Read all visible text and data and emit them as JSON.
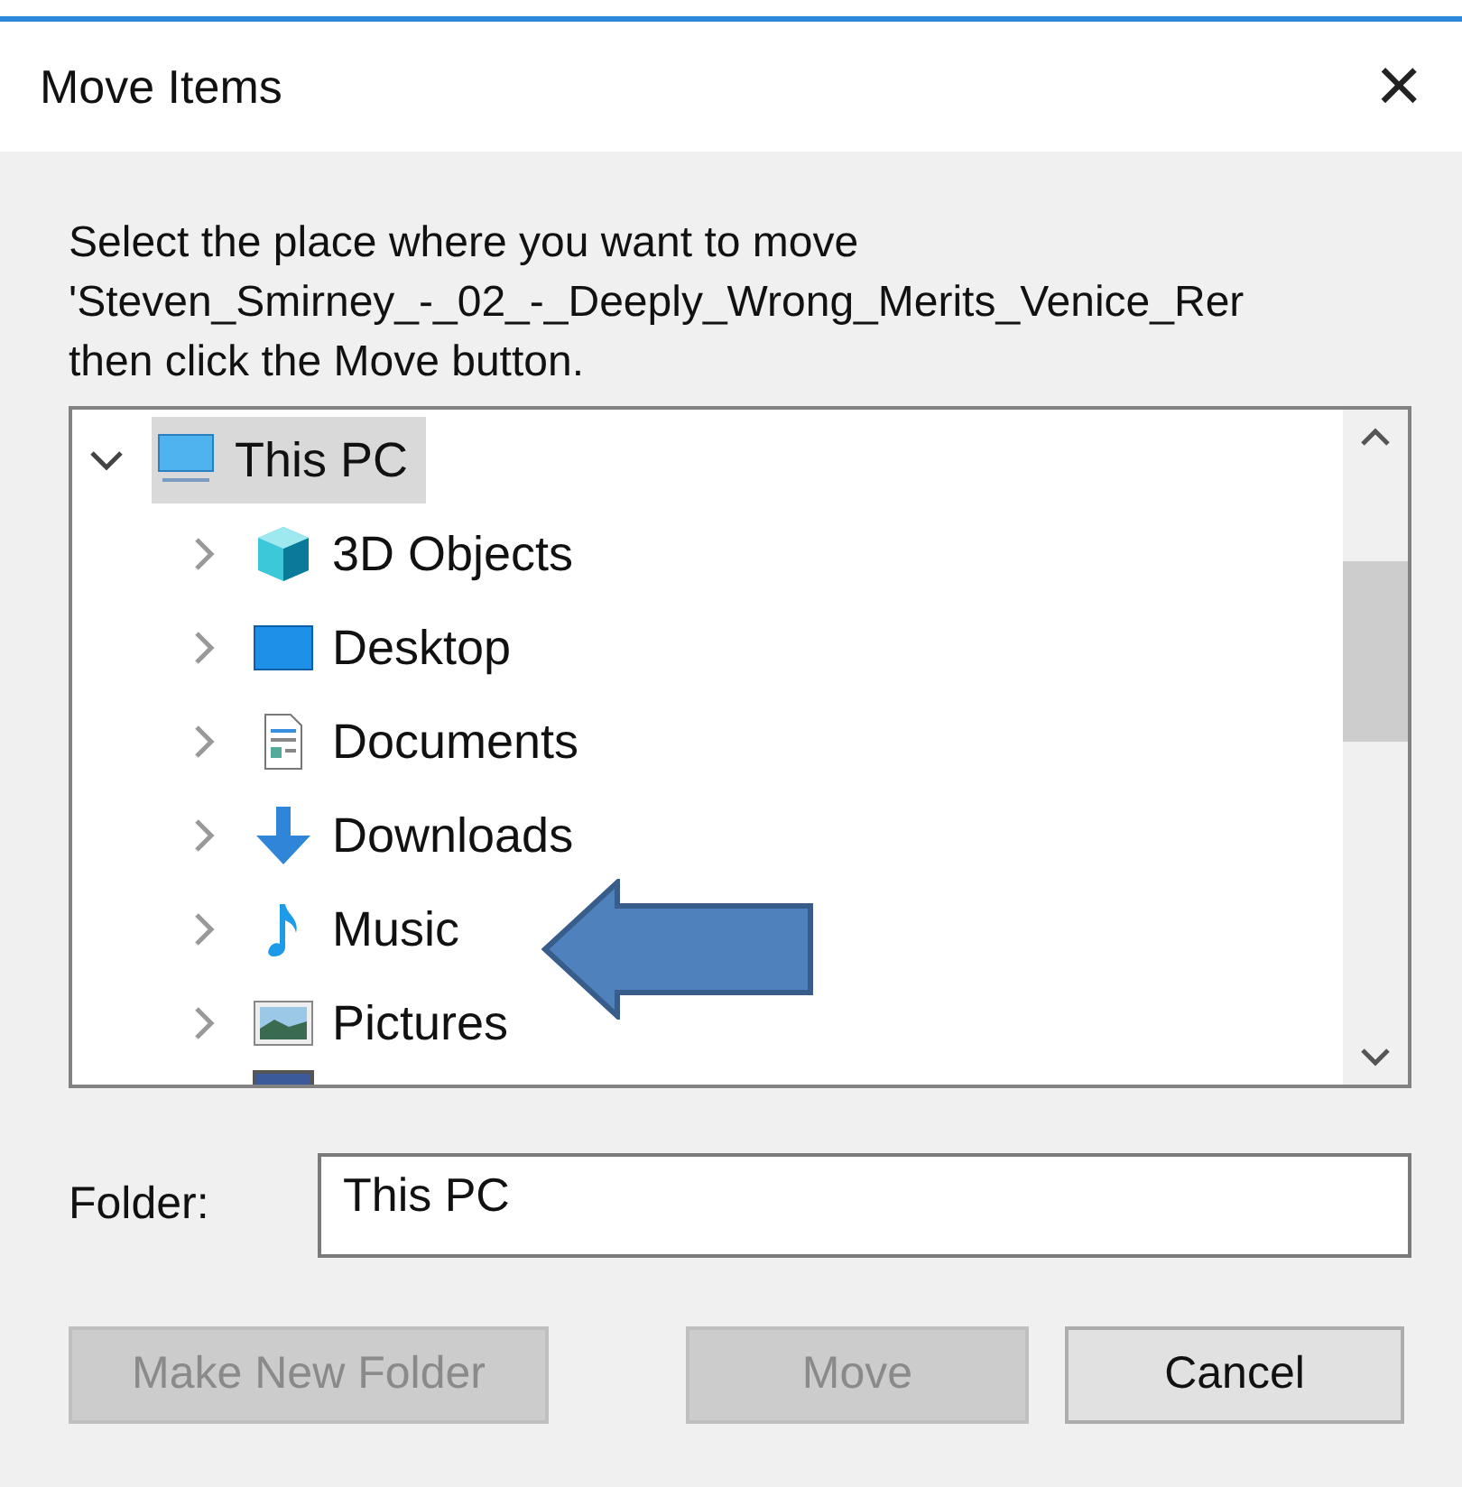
{
  "window": {
    "title": "Move Items",
    "close": "×"
  },
  "instructions": [
    "Select the place where you want to move",
    "'Steven_Smirney_-_02_-_Deeply_Wrong_Merits_Venice_Rer",
    "then click the Move button."
  ],
  "tree": {
    "root": {
      "label": "This PC",
      "kind": "pc",
      "expanded": true,
      "selected": true,
      "children": [
        {
          "label": "3D Objects",
          "kind": "cube",
          "expanded": false,
          "selected": false
        },
        {
          "label": "Desktop",
          "kind": "desktop",
          "expanded": false,
          "selected": false
        },
        {
          "label": "Documents",
          "kind": "document",
          "expanded": false,
          "selected": false
        },
        {
          "label": "Downloads",
          "kind": "download",
          "expanded": false,
          "selected": false
        },
        {
          "label": "Music",
          "kind": "music",
          "expanded": false,
          "selected": false
        },
        {
          "label": "Pictures",
          "kind": "picture",
          "expanded": false,
          "selected": false
        }
      ]
    }
  },
  "folder": {
    "label": "Folder:",
    "value": "This PC"
  },
  "buttons": [
    {
      "label": "Make New Folder",
      "disabled": true
    },
    {
      "label": "Move",
      "disabled": true
    },
    {
      "label": "Cancel",
      "disabled": false
    }
  ]
}
